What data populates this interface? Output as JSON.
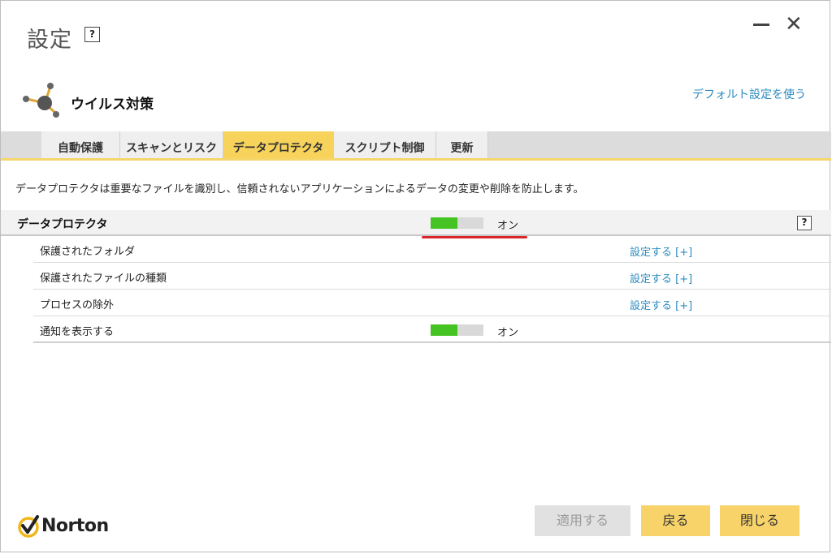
{
  "window": {
    "title": "設定",
    "help_glyph": "?",
    "minimize_icon": "minimize-icon",
    "close_icon": "close-icon",
    "close_glyph": "✕"
  },
  "header": {
    "product_icon": "virus-protection-icon",
    "product_name": "ウイルス対策",
    "default_link": "デフォルト設定を使う"
  },
  "tabs": [
    {
      "label": "自動保護",
      "active": false
    },
    {
      "label": "スキャンとリスク",
      "active": false
    },
    {
      "label": "データプロテクタ",
      "active": true
    },
    {
      "label": "スクリプト制御",
      "active": false
    },
    {
      "label": "更新",
      "active": false
    }
  ],
  "description": "データプロテクタは重要なファイルを識別し、信頼されないアプリケーションによるデータの変更や削除を防止します。",
  "section": {
    "label": "データプロテクタ",
    "toggle_state": "オン",
    "toggle_level": 0.5,
    "help_glyph": "?"
  },
  "rows": [
    {
      "label": "保護されたフォルダ",
      "link": "設定する [+]"
    },
    {
      "label": "保護されたファイルの種類",
      "link": "設定する [+]"
    },
    {
      "label": "プロセスの除外",
      "link": "設定する [+]"
    },
    {
      "label": "通知を表示する",
      "toggle_state": "オン",
      "toggle_level": 0.5
    }
  ],
  "footer": {
    "brand": "Norton",
    "apply_label": "適用する",
    "back_label": "戻る",
    "close_label": "閉じる"
  },
  "colors": {
    "accent_yellow": "#f7d35b",
    "toggle_on": "#44c322",
    "link": "#2c8cc0",
    "highlight_underline": "#d8272a"
  }
}
